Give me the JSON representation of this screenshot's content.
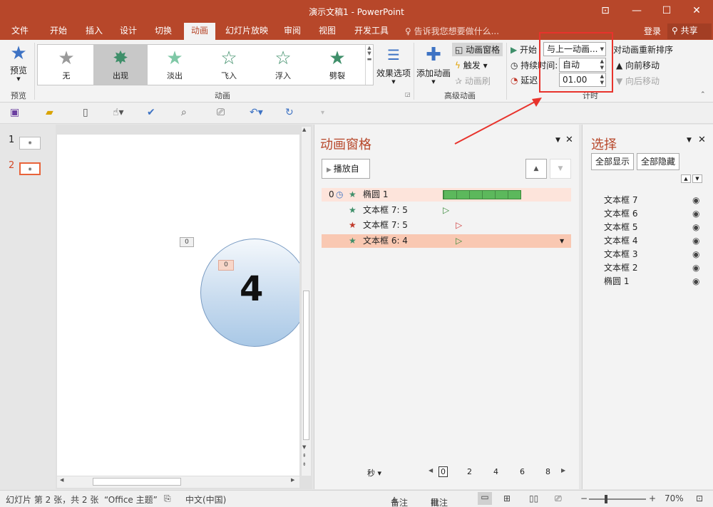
{
  "window": {
    "title": "演示文稿1 - PowerPoint",
    "controls": [
      "⊡",
      "—",
      "☐",
      "✕"
    ]
  },
  "tabs": [
    "文件",
    "开始",
    "插入",
    "设计",
    "切换",
    "动画",
    "幻灯片放映",
    "审阅",
    "视图",
    "开发工具"
  ],
  "tell_me": "告诉我您想要做什么...",
  "account": {
    "login": "登录",
    "share": "共享"
  },
  "ribbon": {
    "preview": {
      "label": "预览",
      "group": "预览"
    },
    "gallery": {
      "items": [
        "无",
        "出现",
        "淡出",
        "飞入",
        "浮入",
        "劈裂"
      ],
      "group": "动画"
    },
    "effect_options": "效果选项",
    "advanced": {
      "add_animation": "添加动画",
      "pane": "动画窗格",
      "trigger": "触发",
      "painter": "动画刷",
      "group": "高级动画"
    },
    "timing": {
      "start_label": "开始",
      "start_value": "与上一动画...",
      "duration_label": "持续时间:",
      "duration_value": "自动",
      "delay_label": "延迟",
      "delay_value": "01.00",
      "group": "计时",
      "reorder": "对动画重新排序",
      "move_earlier": "向前移动",
      "move_later": "向后移动"
    }
  },
  "slides": {
    "numbers": [
      "1",
      "2"
    ],
    "badge_outer": "0",
    "badge_inner": "0",
    "circle_text": "4"
  },
  "animation_pane": {
    "title": "动画窗格",
    "play": "播放自",
    "items": [
      {
        "index": "0",
        "name": "椭圆 1"
      },
      {
        "index": "",
        "name": "文本框 7: 5"
      },
      {
        "index": "",
        "name": "文本框 7: 5"
      },
      {
        "index": "",
        "name": "文本框 6: 4"
      }
    ],
    "seconds": "秒",
    "timeline": [
      "0",
      "2",
      "4",
      "6",
      "8"
    ]
  },
  "selection_pane": {
    "title": "选择",
    "show_all": "全部显示",
    "hide_all": "全部隐藏",
    "items": [
      "文本框 7",
      "文本框 6",
      "文本框 5",
      "文本框 4",
      "文本框 3",
      "文本框 2",
      "椭圆 1"
    ]
  },
  "status": {
    "slide": "幻灯片 第 2 张，共 2 张",
    "theme": "“Office 主题”",
    "language": "中文(中国)",
    "notes": "备注",
    "comments": "批注",
    "zoom": "70%"
  },
  "colors": {
    "brand": "#b7472a",
    "highlight": "#e8332c",
    "bar": "#5cb85c"
  }
}
